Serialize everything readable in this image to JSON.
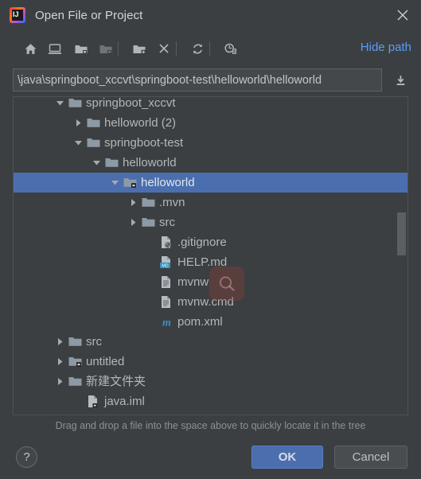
{
  "window": {
    "title": "Open File or Project",
    "logo_letters": "IJ",
    "close_icon": "close-icon"
  },
  "toolbar": {
    "buttons": [
      {
        "name": "home-icon",
        "tooltip": "Home",
        "disabled": false
      },
      {
        "name": "desktop-icon",
        "tooltip": "Desktop",
        "disabled": false
      },
      {
        "name": "project-folder-icon",
        "tooltip": "Project Directory",
        "disabled": false
      },
      {
        "name": "module-folder-icon",
        "tooltip": "Module Directory",
        "disabled": true
      },
      {
        "name": "new-folder-icon",
        "tooltip": "New Folder",
        "disabled": false
      },
      {
        "name": "delete-icon",
        "tooltip": "Delete",
        "disabled": false
      },
      {
        "name": "refresh-icon",
        "tooltip": "Refresh",
        "disabled": false
      },
      {
        "name": "show-hidden-icon",
        "tooltip": "Show Hidden Files",
        "disabled": false
      }
    ],
    "hide_path_label": "Hide path"
  },
  "path": {
    "value": "\\java\\springboot_xccvt\\springboot-test\\helloworld\\helloworld",
    "placeholder": "",
    "expand_icon": "download-icon"
  },
  "tree": {
    "rows": [
      {
        "label": "springboot_xccvt",
        "depth": 3,
        "twisty": "down",
        "icon": "folder",
        "selected": false
      },
      {
        "label": "helloworld (2)",
        "depth": 4,
        "twisty": "right",
        "icon": "folder",
        "selected": false
      },
      {
        "label": "springboot-test",
        "depth": 4,
        "twisty": "down",
        "icon": "folder",
        "selected": false
      },
      {
        "label": "helloworld",
        "depth": 5,
        "twisty": "down",
        "icon": "folder",
        "selected": false
      },
      {
        "label": "helloworld",
        "depth": 6,
        "twisty": "down",
        "icon": "folder-module",
        "selected": true
      },
      {
        "label": ".mvn",
        "depth": 7,
        "twisty": "right",
        "icon": "folder",
        "selected": false
      },
      {
        "label": "src",
        "depth": 7,
        "twisty": "right",
        "icon": "folder",
        "selected": false
      },
      {
        "label": ".gitignore",
        "depth": 8,
        "twisty": "none",
        "icon": "file-ignored",
        "selected": false
      },
      {
        "label": "HELP.md",
        "depth": 8,
        "twisty": "none",
        "icon": "file-md",
        "selected": false
      },
      {
        "label": "mvnw",
        "depth": 8,
        "twisty": "none",
        "icon": "file-text",
        "selected": false
      },
      {
        "label": "mvnw.cmd",
        "depth": 8,
        "twisty": "none",
        "icon": "file-text",
        "selected": false
      },
      {
        "label": "pom.xml",
        "depth": 8,
        "twisty": "none",
        "icon": "file-maven",
        "selected": false
      },
      {
        "label": "src",
        "depth": 3,
        "twisty": "right",
        "icon": "folder",
        "selected": false
      },
      {
        "label": "untitled",
        "depth": 3,
        "twisty": "right",
        "icon": "folder-module",
        "selected": false
      },
      {
        "label": "新建文件夹",
        "depth": 3,
        "twisty": "right",
        "icon": "folder",
        "selected": false
      },
      {
        "label": "java.iml",
        "depth": 4,
        "twisty": "none",
        "icon": "file-iml",
        "selected": false
      }
    ],
    "scrollbar": {
      "name": "vertical-scrollbar",
      "visible": true
    }
  },
  "overlay": {
    "magnifier_icon": "magnifier-icon"
  },
  "hint": {
    "text": "Drag and drop a file into the space above to quickly locate it in the tree"
  },
  "footer": {
    "help_label": "?",
    "ok_label": "OK",
    "cancel_label": "Cancel"
  },
  "colors": {
    "background": "#3c3f41",
    "selection": "#4b6eaf",
    "link": "#589df6",
    "text": "#b4b7ba",
    "folder": "#8d9aa5",
    "maven_blue": "#3592c4"
  }
}
